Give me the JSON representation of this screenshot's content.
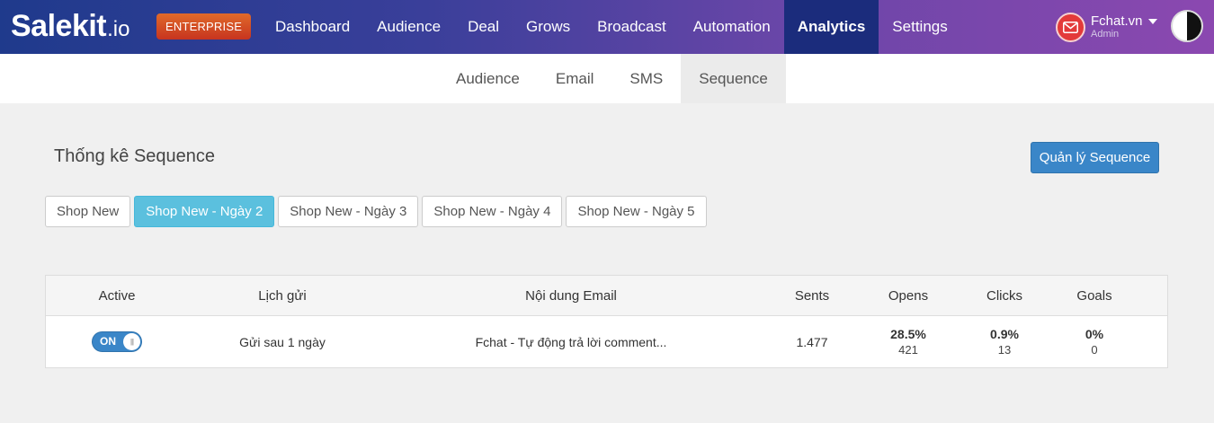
{
  "brand": {
    "name": "Salekit",
    "suffix": ".io",
    "badge": "ENTERPRISE"
  },
  "nav": {
    "items": [
      "Dashboard",
      "Audience",
      "Deal",
      "Grows",
      "Broadcast",
      "Automation",
      "Analytics",
      "Settings"
    ],
    "active": "Analytics"
  },
  "user": {
    "name": "Fchat.vn",
    "role": "Admin"
  },
  "subnav": {
    "items": [
      "Audience",
      "Email",
      "SMS",
      "Sequence"
    ],
    "active": "Sequence"
  },
  "page": {
    "title": "Thống kê Sequence",
    "manage_button": "Quản lý Sequence"
  },
  "tabs": {
    "items": [
      "Shop New",
      "Shop New - Ngày 2",
      "Shop New - Ngày 3",
      "Shop New - Ngày 4",
      "Shop New - Ngày 5"
    ],
    "active": "Shop New - Ngày 2"
  },
  "table": {
    "headers": {
      "active": "Active",
      "schedule": "Lịch gửi",
      "content": "Nội dung Email",
      "sents": "Sents",
      "opens": "Opens",
      "clicks": "Clicks",
      "goals": "Goals"
    },
    "rows": [
      {
        "toggle": "ON",
        "schedule": "Gửi sau 1 ngày",
        "content": "Fchat - Tự động trả lời comment...",
        "sents": "1.477",
        "opens_pct": "28.5%",
        "opens": "421",
        "clicks_pct": "0.9%",
        "clicks": "13",
        "goals_pct": "0%",
        "goals": "0"
      }
    ]
  },
  "colors": {
    "primary": "#3a86c8",
    "tab_active": "#5bc0de",
    "badge": "#d04a24",
    "nav_active": "#1b2c7c"
  }
}
